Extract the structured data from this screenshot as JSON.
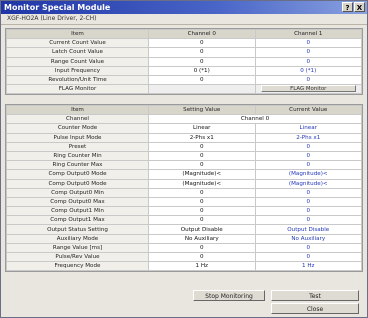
{
  "window": {
    "title": "Monitor Special Module",
    "help_btn": "?",
    "close_btn": "X"
  },
  "module": {
    "name": "XGF-HO2A (Line Driver, 2-CH)"
  },
  "table1": {
    "headers": [
      "Item",
      "Channel 0",
      "Channel 1"
    ],
    "rows": [
      {
        "label": "Current Count Value",
        "c0": "0",
        "c1": "0"
      },
      {
        "label": "Latch Count Value",
        "c0": "0",
        "c1": "0"
      },
      {
        "label": "Range Count Value",
        "c0": "0",
        "c1": "0"
      },
      {
        "label": "Input Frequency",
        "c0": "0  (*1)",
        "c1": "0  (*1)"
      },
      {
        "label": "Revolution/Unit Time",
        "c0": "0",
        "c1": "0"
      }
    ],
    "flag_row": {
      "label": "FLAG Monitor",
      "button": "FLAG Monitor"
    }
  },
  "table2": {
    "headers": [
      "Item",
      "Setting Value",
      "Current Value"
    ],
    "channel_row": {
      "label": "Channel",
      "value": "Channel 0"
    },
    "rows": [
      {
        "label": "Counter Mode",
        "set": "Linear",
        "cur": "Linear"
      },
      {
        "label": "Pulse Input Mode",
        "set": "2-Phs x1",
        "cur": "2-Phs x1"
      },
      {
        "label": "Preset",
        "set": "0",
        "cur": "0"
      },
      {
        "label": "Ring Counter Min",
        "set": "0",
        "cur": "0"
      },
      {
        "label": "Ring Counter Max",
        "set": "0",
        "cur": "0"
      },
      {
        "label": "Comp Output0 Mode",
        "set": "(Magnitude)<",
        "cur": "(Magnitude)<"
      },
      {
        "label": "Comp Output0 Mode",
        "set": "(Magnitude)<",
        "cur": "(Magnitude)<"
      },
      {
        "label": "Comp Output0 Min",
        "set": "0",
        "cur": "0"
      },
      {
        "label": "Comp Output0 Max",
        "set": "0",
        "cur": "0"
      },
      {
        "label": "Comp Output1 Min",
        "set": "0",
        "cur": "0"
      },
      {
        "label": "Comp Output1 Max",
        "set": "0",
        "cur": "0"
      },
      {
        "label": "Output Status Setting",
        "set": "Output Disable",
        "cur": "Output Disable"
      },
      {
        "label": "Auxiliary Mode",
        "set": "No Auxiliary",
        "cur": "No Auxiliary"
      },
      {
        "label": "Range Value [ms]",
        "set": "0",
        "cur": "0"
      },
      {
        "label": "Pulse/Rev Value",
        "set": "0",
        "cur": "0"
      },
      {
        "label": "Frequency Mode",
        "set": "1 Hz",
        "cur": "1 Hz"
      }
    ]
  },
  "buttons": {
    "stop": "Stop Monitoring",
    "test": "Test",
    "close": "Close"
  }
}
